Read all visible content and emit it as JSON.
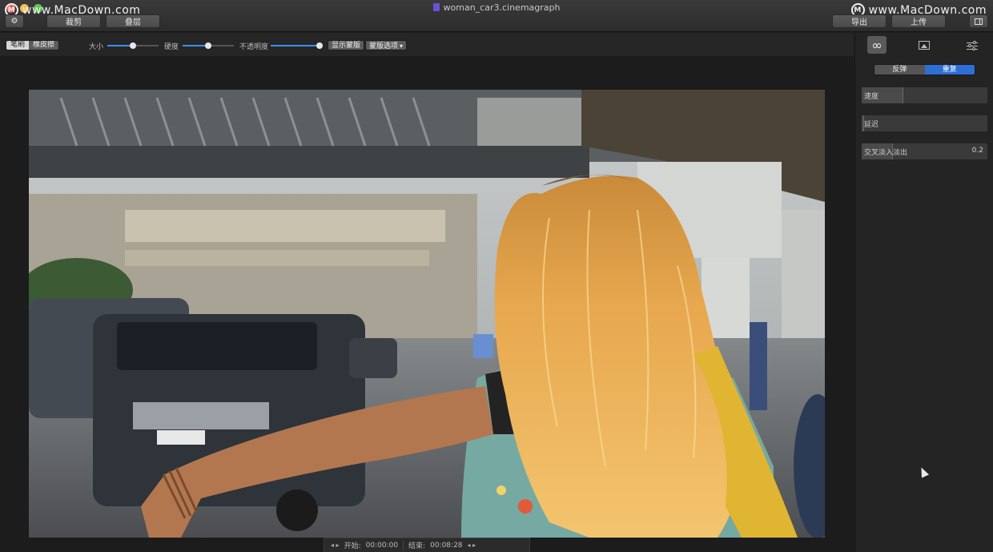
{
  "watermark": {
    "text": "www.MacDown.com",
    "logo_letter": "M"
  },
  "window": {
    "title": "woman_car3.cinemagraph"
  },
  "titlebar": {
    "crop_label": "裁剪",
    "overlay_label": "叠层",
    "export_label": "导出",
    "upload_label": "上传"
  },
  "toolbar": {
    "brush_label": "笔刷",
    "eraser_label": "橡皮擦",
    "size_label": "大小",
    "size_value": 0.5,
    "hardness_label": "硬度",
    "hardness_value": 0.5,
    "opacity_label": "不透明度",
    "opacity_value": 0.95,
    "show_mask_label": "显示蒙版",
    "mask_options_label": "蒙版选项"
  },
  "timeline": {
    "start_label": "开始:",
    "start_time": "00:00:00",
    "end_label": "结束:",
    "end_time": "00:08:28"
  },
  "panel": {
    "tab_icons": [
      "loop-icon",
      "image-icon",
      "adjustments-icon"
    ],
    "mode_bounce": "反弹",
    "mode_repeat": "重复",
    "speed_label": "速度",
    "speed_fraction": 0.33,
    "delay_label": "延迟",
    "delay_fraction": 0.02,
    "crossfade_label": "交叉淡入淡出",
    "crossfade_value": "0.2",
    "crossfade_fraction": 0.25
  },
  "colors": {
    "accent": "#3a8ff0",
    "selected": "#2d6fd6",
    "background": "#1e1e1e"
  }
}
